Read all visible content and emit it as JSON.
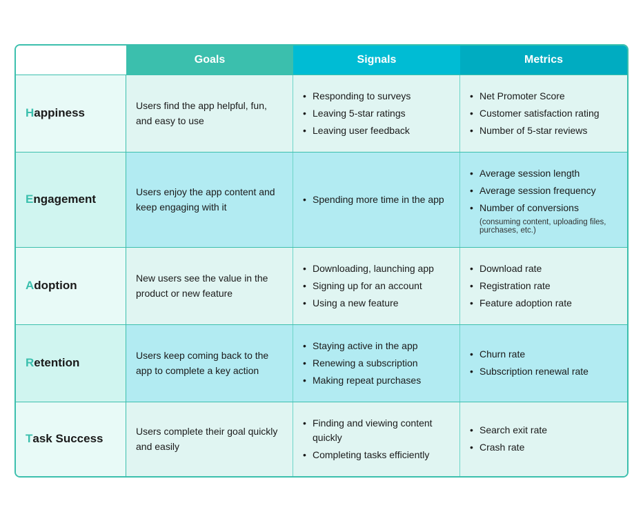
{
  "headers": {
    "empty": "",
    "goals": "Goals",
    "signals": "Signals",
    "metrics": "Metrics"
  },
  "rows": [
    {
      "id": "happiness",
      "label_prefix": "H",
      "label_rest": "appiness",
      "goal": "Users find the app helpful, fun, and easy to use",
      "signals": [
        "Responding to surveys",
        "Leaving 5-star ratings",
        "Leaving user feedback"
      ],
      "metrics": [
        "Net Promoter Score",
        "Customer satisfaction rating",
        "Number of 5-star reviews"
      ],
      "metrics_note": null
    },
    {
      "id": "engagement",
      "label_prefix": "E",
      "label_rest": "ngagement",
      "goal": "Users enjoy the app content and keep engaging with it",
      "signals": [
        "Spending more time in the app"
      ],
      "metrics": [
        "Average session length",
        "Average session frequency",
        "Number of conversions"
      ],
      "metrics_note": "(consuming content, uploading files, purchases, etc.)"
    },
    {
      "id": "adoption",
      "label_prefix": "A",
      "label_rest": "doption",
      "goal": "New users see the value in the product or new feature",
      "signals": [
        "Downloading, launching app",
        "Signing up for an account",
        "Using a new feature"
      ],
      "metrics": [
        "Download rate",
        "Registration rate",
        "Feature adoption rate"
      ],
      "metrics_note": null
    },
    {
      "id": "retention",
      "label_prefix": "R",
      "label_rest": "etention",
      "goal": "Users keep coming back to the app to complete a key action",
      "signals": [
        "Staying active in the app",
        "Renewing a subscription",
        "Making repeat purchases"
      ],
      "metrics": [
        "Churn rate",
        "Subscription renewal rate"
      ],
      "metrics_note": null
    },
    {
      "id": "task-success",
      "label_prefix": "T",
      "label_rest": "ask Success",
      "goal": "Users complete their goal quickly and easily",
      "signals": [
        "Finding and viewing content quickly",
        "Completing tasks efficiently"
      ],
      "metrics": [
        "Search exit rate",
        "Crash rate"
      ],
      "metrics_note": null
    }
  ]
}
